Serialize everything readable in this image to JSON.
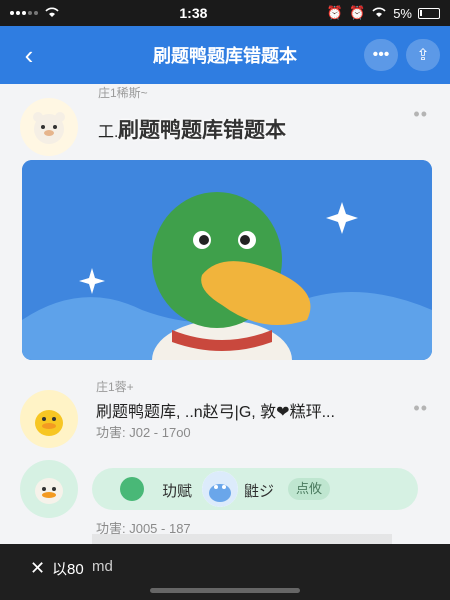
{
  "status_bar": {
    "time": "1:38",
    "battery": "5%"
  },
  "nav": {
    "title": "刷题鸭题库错题本",
    "back_icon": "chevron-left-icon",
    "more_icon": "more-horizontal-icon",
    "share_icon": "share-icon"
  },
  "posts": [
    {
      "username": "庄1稀斯~",
      "overlay_title": "刷题鸭题库错题本",
      "text": "工...",
      "avatar": "bear-avatar"
    },
    {
      "username": "庄1蓉+",
      "text": "刷题鸭题库, ..n赵弓|G, 敦❤糕玶...",
      "meta": "功害: J02 - 17o0",
      "avatar": "duck-avatar"
    },
    {
      "bubble_text_1": "玏赋",
      "bubble_text_2": "鼪ジ",
      "bubble_chip": "点攸",
      "meta": "功害: J005 - 187",
      "avatar": "white-duck-avatar"
    }
  ],
  "bottom_bar": {
    "close_icon": "close-icon",
    "label_1": "以80",
    "label_2": "md"
  },
  "colors": {
    "nav_blue": "#2f7de1",
    "scene_blue": "#3f86de",
    "bubble_green": "#d6f1e3"
  }
}
